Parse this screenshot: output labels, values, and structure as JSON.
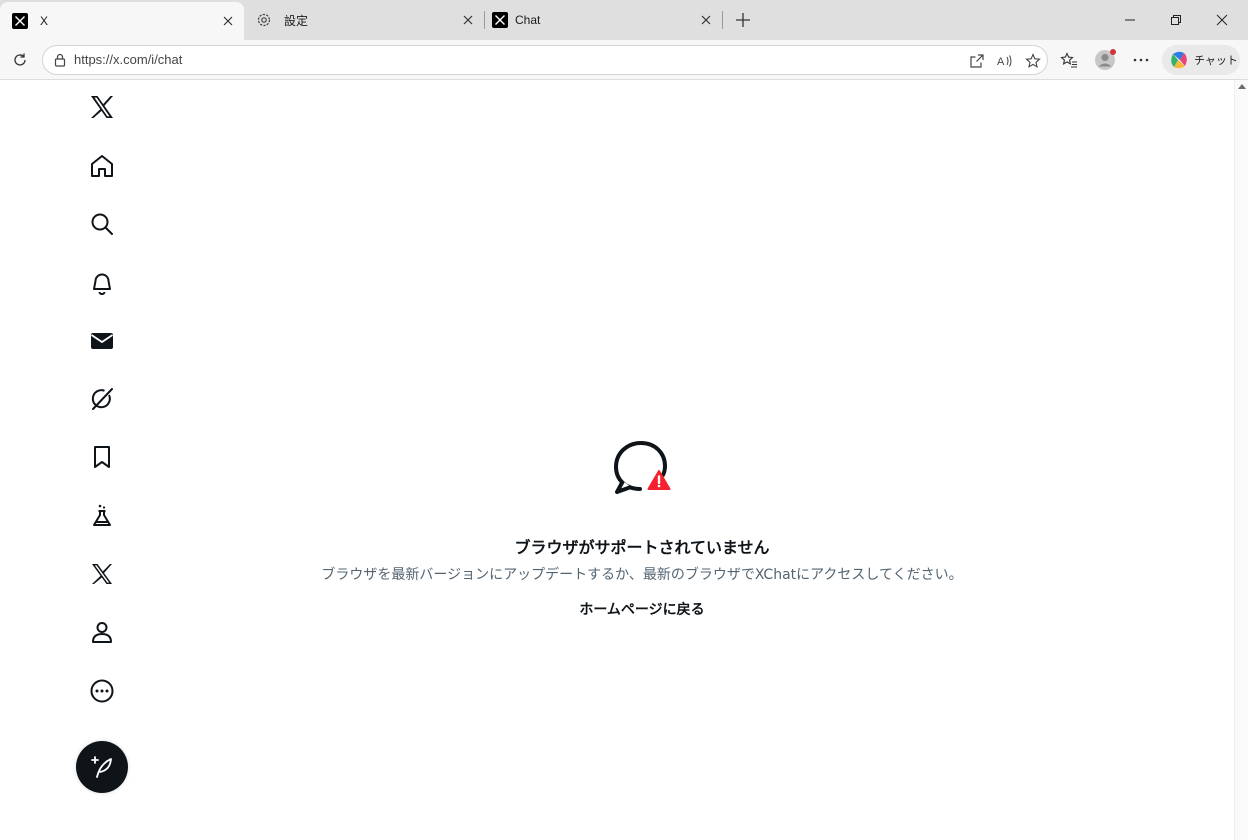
{
  "browser": {
    "tabs": [
      {
        "title": "X",
        "icon": "x-logo-icon",
        "active": true
      },
      {
        "title": "設定",
        "icon": "gear-icon",
        "active": false
      },
      {
        "title": "Chat",
        "icon": "x-logo-icon",
        "active": false
      }
    ],
    "address": {
      "url": "https://x.com/i/chat"
    },
    "copilot_label": "チャット"
  },
  "sidebar": {
    "items": [
      {
        "name": "x-logo-icon"
      },
      {
        "name": "home-icon"
      },
      {
        "name": "search-icon"
      },
      {
        "name": "notifications-bell-icon"
      },
      {
        "name": "messages-envelope-icon"
      },
      {
        "name": "grok-icon"
      },
      {
        "name": "bookmark-icon"
      },
      {
        "name": "jobs-flask-icon"
      },
      {
        "name": "premium-x-icon"
      },
      {
        "name": "profile-person-icon"
      },
      {
        "name": "more-ellipsis-icon"
      }
    ],
    "post_button_icon": "compose-feather-icon"
  },
  "main": {
    "error_title": "ブラウザがサポートされていません",
    "error_description": "ブラウザを最新バージョンにアップデートするか、最新のブラウザでXChatにアクセスしてください。",
    "home_link": "ホームページに戻る"
  },
  "colors": {
    "text_primary": "#0f1419",
    "text_secondary": "#536471",
    "alert_red": "#f4212e"
  }
}
